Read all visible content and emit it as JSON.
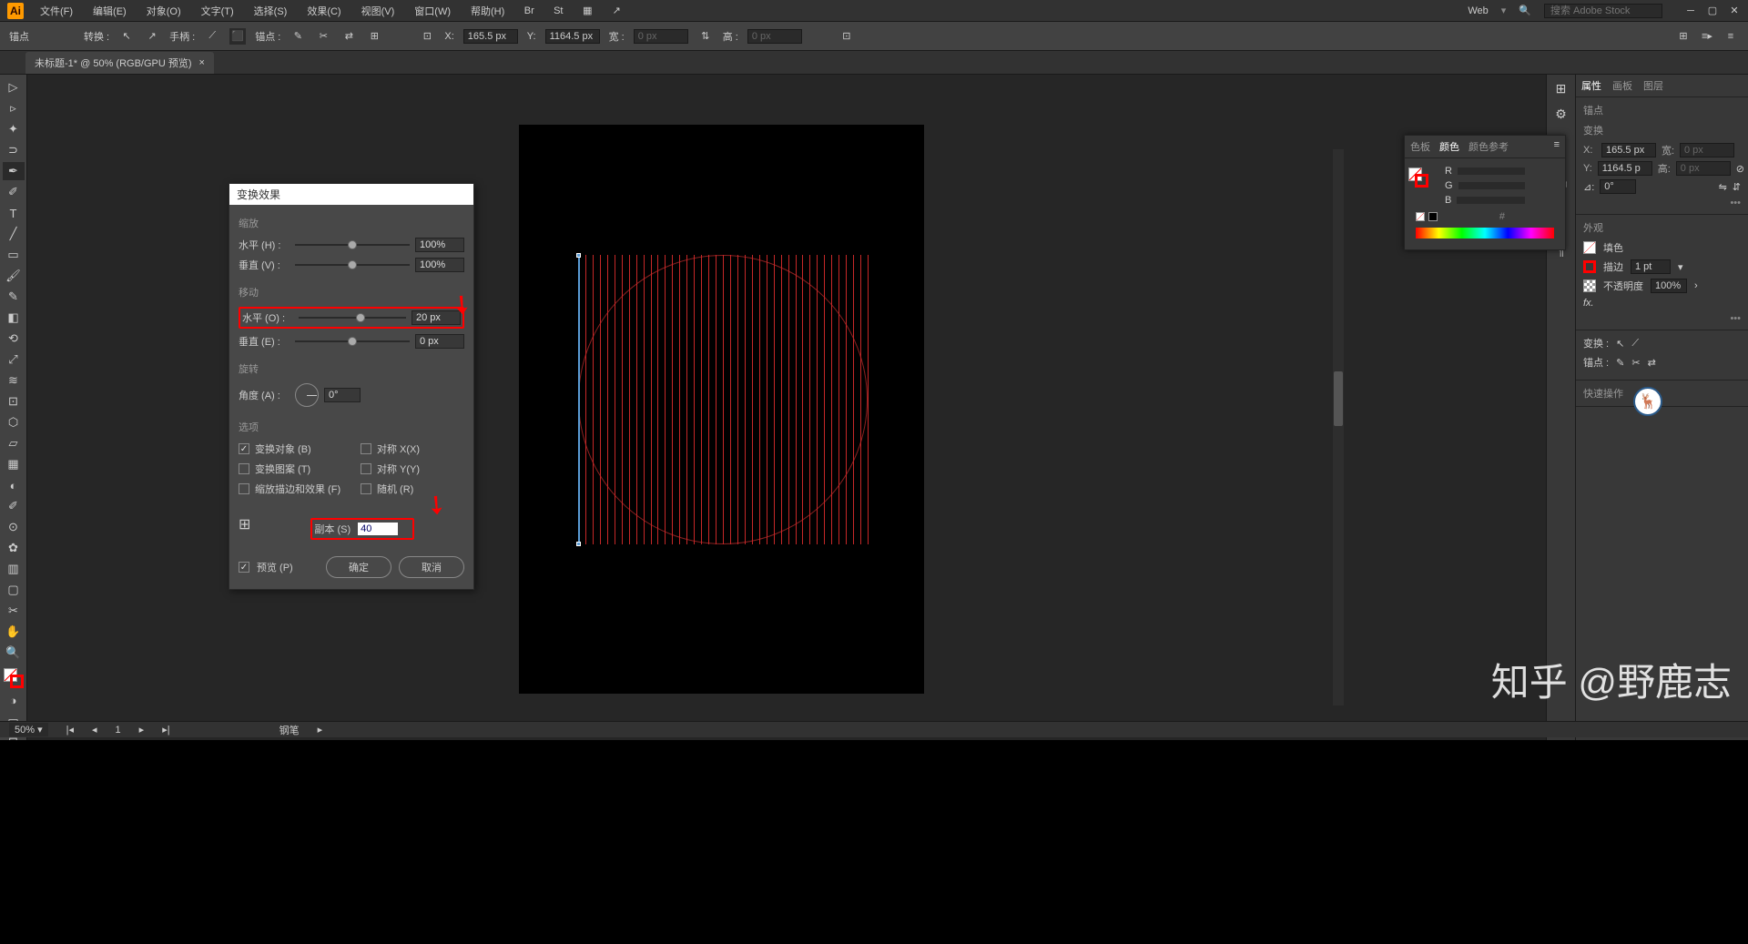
{
  "menubar": {
    "items": [
      "文件(F)",
      "编辑(E)",
      "对象(O)",
      "文字(T)",
      "选择(S)",
      "效果(C)",
      "视图(V)",
      "窗口(W)",
      "帮助(H)"
    ],
    "workspace": "Web",
    "search_placeholder": "搜索 Adobe Stock"
  },
  "controlbar": {
    "anchor": "锚点",
    "transform": "转换 :",
    "handle": "手柄 :",
    "anchors": "锚点 :",
    "x_label": "X:",
    "x_val": "165.5 px",
    "y_label": "Y:",
    "y_val": "1164.5 px",
    "w_label": "宽 :",
    "w_val": "0 px",
    "h_label": "高 :",
    "h_val": "0 px"
  },
  "tab": {
    "title": "未标题-1* @ 50% (RGB/GPU 预览)"
  },
  "dialog": {
    "title": "变换效果",
    "scale": {
      "section": "缩放",
      "h_label": "水平 (H) :",
      "h_val": "100%",
      "v_label": "垂直 (V) :",
      "v_val": "100%"
    },
    "move": {
      "section": "移动",
      "h_label": "水平 (O) :",
      "h_val": "20 px",
      "v_label": "垂直 (E) :",
      "v_val": "0 px"
    },
    "rotate": {
      "section": "旋转",
      "angle_label": "角度 (A) :",
      "angle_val": "0°"
    },
    "options": {
      "section": "选项",
      "transform_obj": "变换对象 (B)",
      "transform_pattern": "变换图案 (T)",
      "scale_stroke": "缩放描边和效果 (F)",
      "reflect_x": "对称 X(X)",
      "reflect_y": "对称 Y(Y)",
      "random": "随机 (R)"
    },
    "copies_label": "副本 (S)",
    "copies_val": "40",
    "preview": "预览 (P)",
    "ok": "确定",
    "cancel": "取消"
  },
  "prop_panel": {
    "tabs": [
      "属性",
      "画板",
      "图层"
    ],
    "anchor": "锚点",
    "transform": "变换",
    "x": "165.5 px",
    "y": "1164.5 p",
    "w": "0 px",
    "h": "0 px",
    "appearance": "外观",
    "fill": "填色",
    "stroke": "描边",
    "stroke_val": "1 pt",
    "opacity_label": "不透明度",
    "opacity": "100%",
    "fx": "fx.",
    "transform2": "变换 :",
    "anchors2": "锚点 :",
    "quick": "快速操作"
  },
  "color_panel": {
    "tabs": [
      "色板",
      "颜色",
      "颜色参考"
    ],
    "r": "R",
    "g": "G",
    "b": "B"
  },
  "statusbar": {
    "zoom": "50%",
    "page": "1",
    "tool": "钢笔"
  },
  "watermark": "知乎 @野鹿志"
}
